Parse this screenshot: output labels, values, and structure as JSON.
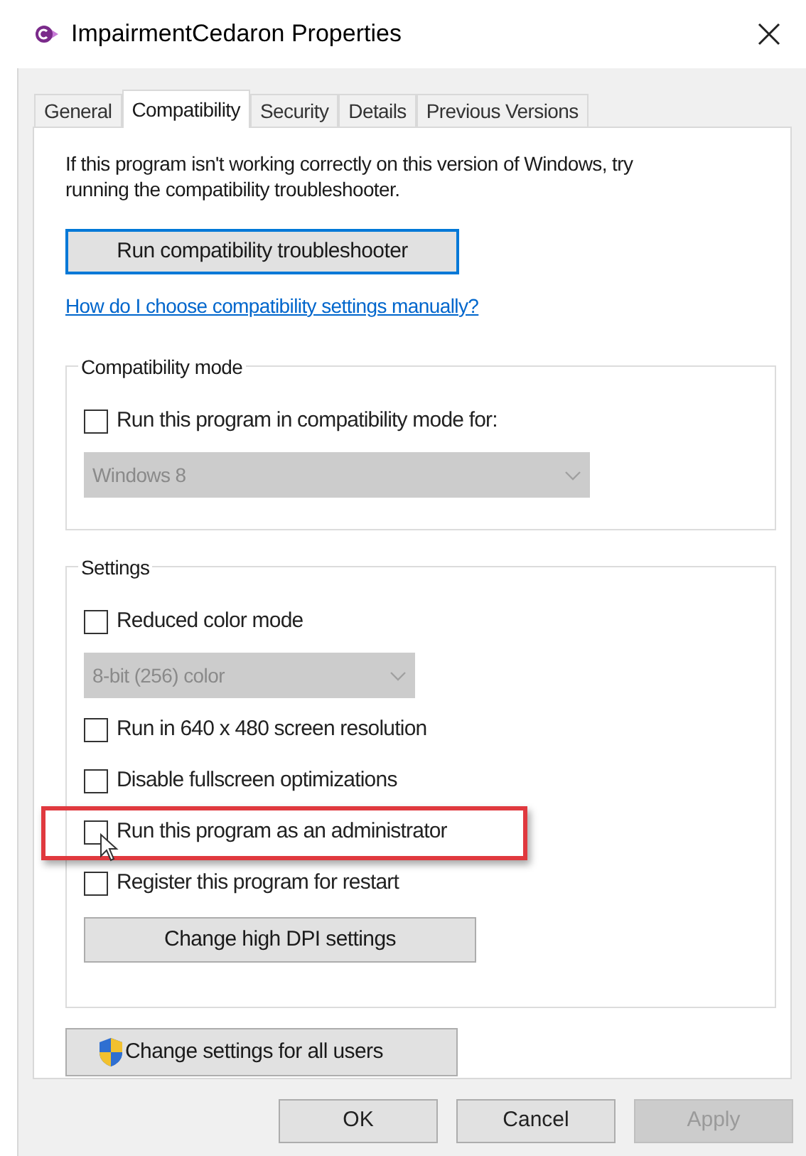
{
  "window": {
    "title": "ImpairmentCedaron Properties"
  },
  "tabs": [
    {
      "label": "General",
      "selected": false
    },
    {
      "label": "Compatibility",
      "selected": true
    },
    {
      "label": "Security",
      "selected": false
    },
    {
      "label": "Details",
      "selected": false
    },
    {
      "label": "Previous Versions",
      "selected": false
    }
  ],
  "intro": "If this program isn't working correctly on this version of Windows, try running the compatibility troubleshooter.",
  "troubleshooter_button": {
    "label": "Run compatibility troubleshooter",
    "focused": true
  },
  "help_link": "How do I choose compatibility settings manually?",
  "compatibility_mode": {
    "label": "Compatibility mode",
    "items": [
      {
        "kind": "checkbox",
        "label": "Run this program in compatibility mode for:",
        "checked": false,
        "highlighted": false,
        "pointer": false
      },
      {
        "kind": "dropdown",
        "value": "Windows 8",
        "disabled": true
      }
    ]
  },
  "settings": {
    "label": "Settings",
    "items": [
      {
        "kind": "checkbox",
        "label": "Reduced color mode",
        "checked": false,
        "highlighted": false,
        "pointer": false
      },
      {
        "kind": "dropdown",
        "value": "8-bit (256) color",
        "disabled": true
      },
      {
        "kind": "checkbox",
        "label": "Run in 640 x 480 screen resolution",
        "checked": false,
        "highlighted": false,
        "pointer": false
      },
      {
        "kind": "checkbox",
        "label": "Disable fullscreen optimizations",
        "checked": false,
        "highlighted": false,
        "pointer": false
      },
      {
        "kind": "checkbox",
        "label": "Run this program as an administrator",
        "checked": false,
        "highlighted": true,
        "pointer": true
      },
      {
        "kind": "checkbox",
        "label": "Register this program for restart",
        "checked": false,
        "highlighted": false,
        "pointer": false
      },
      {
        "kind": "button",
        "label": "Change high DPI settings"
      }
    ]
  },
  "all_users_button": {
    "label": "Change settings for all users"
  },
  "buttons": [
    {
      "label": "OK",
      "disabled": false
    },
    {
      "label": "Cancel",
      "disabled": false
    },
    {
      "label": "Apply",
      "disabled": true
    }
  ]
}
